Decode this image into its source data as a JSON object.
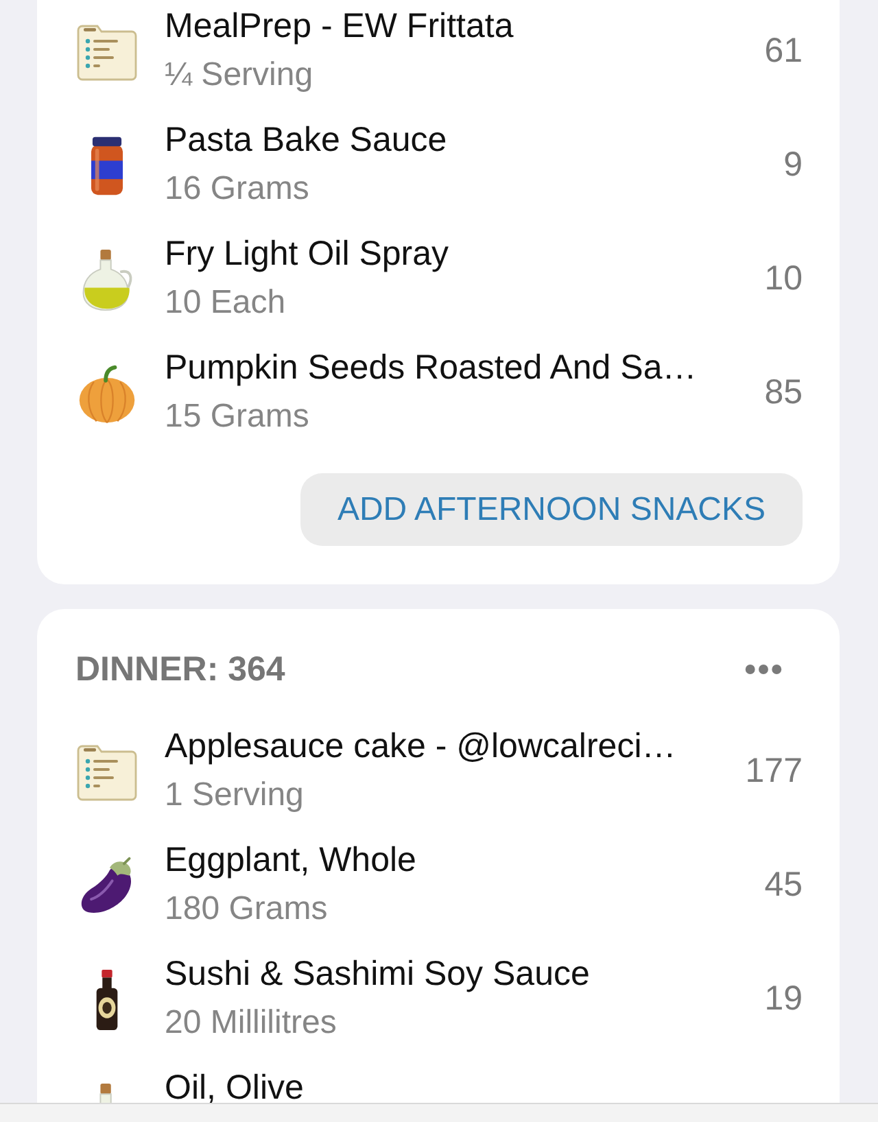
{
  "sections": [
    {
      "items": [
        {
          "kind": "recipe",
          "name": "MealPrep - EW Frittata",
          "amount": "¼ Serving",
          "calories": "61"
        },
        {
          "kind": "jar",
          "name": "Pasta Bake Sauce",
          "amount": "16 Grams",
          "calories": "9"
        },
        {
          "kind": "oil",
          "name": "Fry Light Oil Spray",
          "amount": "10 Each",
          "calories": "10"
        },
        {
          "kind": "pumpkin",
          "name": "Pumpkin Seeds Roasted And Sa…",
          "amount": "15 Grams",
          "calories": "85"
        }
      ],
      "add_button": "ADD AFTERNOON SNACKS"
    },
    {
      "title": "DINNER: 364",
      "items": [
        {
          "kind": "recipe",
          "name": "Applesauce cake - @lowcalreci…",
          "amount": "1 Serving",
          "calories": "177"
        },
        {
          "kind": "eggplant",
          "name": "Eggplant, Whole",
          "amount": "180 Grams",
          "calories": "45"
        },
        {
          "kind": "soy",
          "name": "Sushi & Sashimi Soy Sauce",
          "amount": "20 Millilitres",
          "calories": "19"
        },
        {
          "kind": "oil",
          "name": "Oil, Olive"
        }
      ]
    }
  ]
}
